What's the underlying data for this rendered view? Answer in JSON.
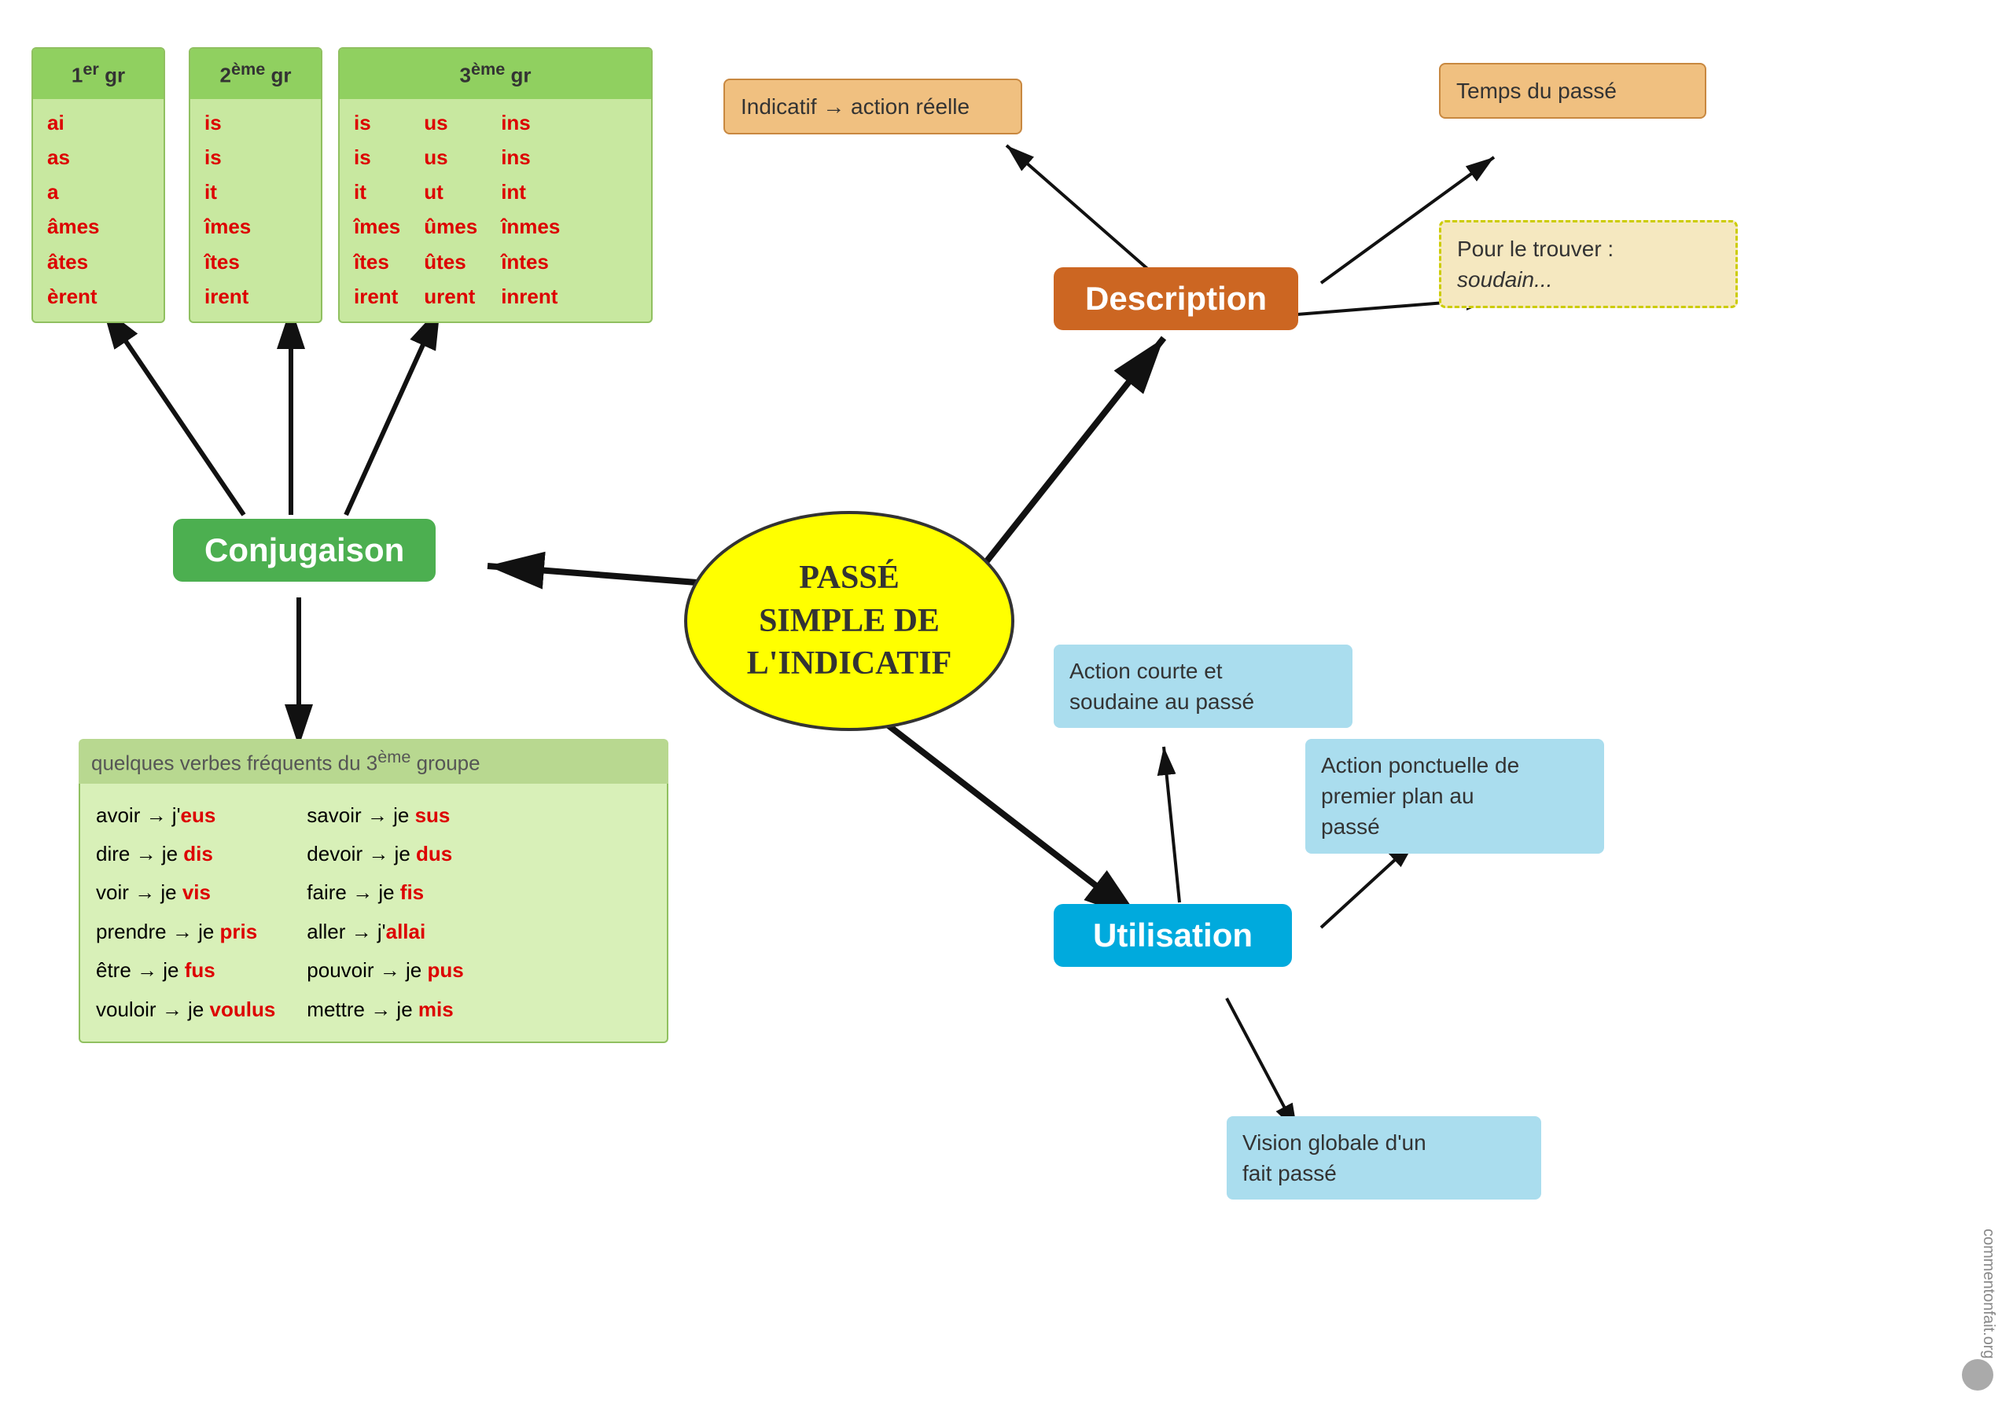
{
  "title": "Passé simple de l'indicatif",
  "center": {
    "line1": "Passé",
    "line2": "simple de",
    "line3": "l'indicatif"
  },
  "conjugaison": {
    "label": "Conjugaison"
  },
  "description": {
    "label": "Description",
    "box1": "Indicatif → action réelle",
    "box2": "Temps du passé",
    "box3_italic": "soudain...",
    "box3_prefix": "Pour le trouver :"
  },
  "utilisation": {
    "label": "Utilisation",
    "box1_line1": "Action courte et",
    "box1_line2": "soudaine au passé",
    "box2_line1": "Action ponctuelle de",
    "box2_line2": "premier plan au",
    "box2_line3": "passé",
    "box3_line1": "Vision globale d'un",
    "box3_line2": "fait passé"
  },
  "gr1": {
    "header": "1er gr",
    "endings": [
      "ai",
      "as",
      "a",
      "âmes",
      "âtes",
      "èrent"
    ]
  },
  "gr2": {
    "header": "2ème gr",
    "endings": [
      "is",
      "is",
      "it",
      "îmes",
      "îtes",
      "irent"
    ]
  },
  "gr3": {
    "header": "3ème gr",
    "col1": [
      "is",
      "is",
      "it",
      "îmes",
      "îtes",
      "irent"
    ],
    "col2": [
      "us",
      "us",
      "ut",
      "ûmes",
      "ûtes",
      "urent"
    ],
    "col3": [
      "ins",
      "ins",
      "int",
      "înmes",
      "întes",
      "inrent"
    ]
  },
  "verbes": {
    "header": "quelques verbes fréquents du 3ème groupe",
    "col1": [
      {
        "base": "avoir → j'",
        "form": "eus"
      },
      {
        "base": "dire → je ",
        "form": "dis"
      },
      {
        "base": "voir → je ",
        "form": "vis"
      },
      {
        "base": "prendre → je ",
        "form": "pris"
      },
      {
        "base": "être → je ",
        "form": "fus"
      },
      {
        "base": "vouloir → je ",
        "form": "voulus"
      }
    ],
    "col2": [
      {
        "base": "savoir → je ",
        "form": "sus"
      },
      {
        "base": "devoir → je ",
        "form": "dus"
      },
      {
        "base": "faire → je ",
        "form": "fis"
      },
      {
        "base": "aller → j'",
        "form": "allai"
      },
      {
        "base": "pouvoir → je ",
        "form": "pus"
      },
      {
        "base": "mettre → je ",
        "form": "mis"
      }
    ]
  },
  "watermark": "commentonfait.org"
}
